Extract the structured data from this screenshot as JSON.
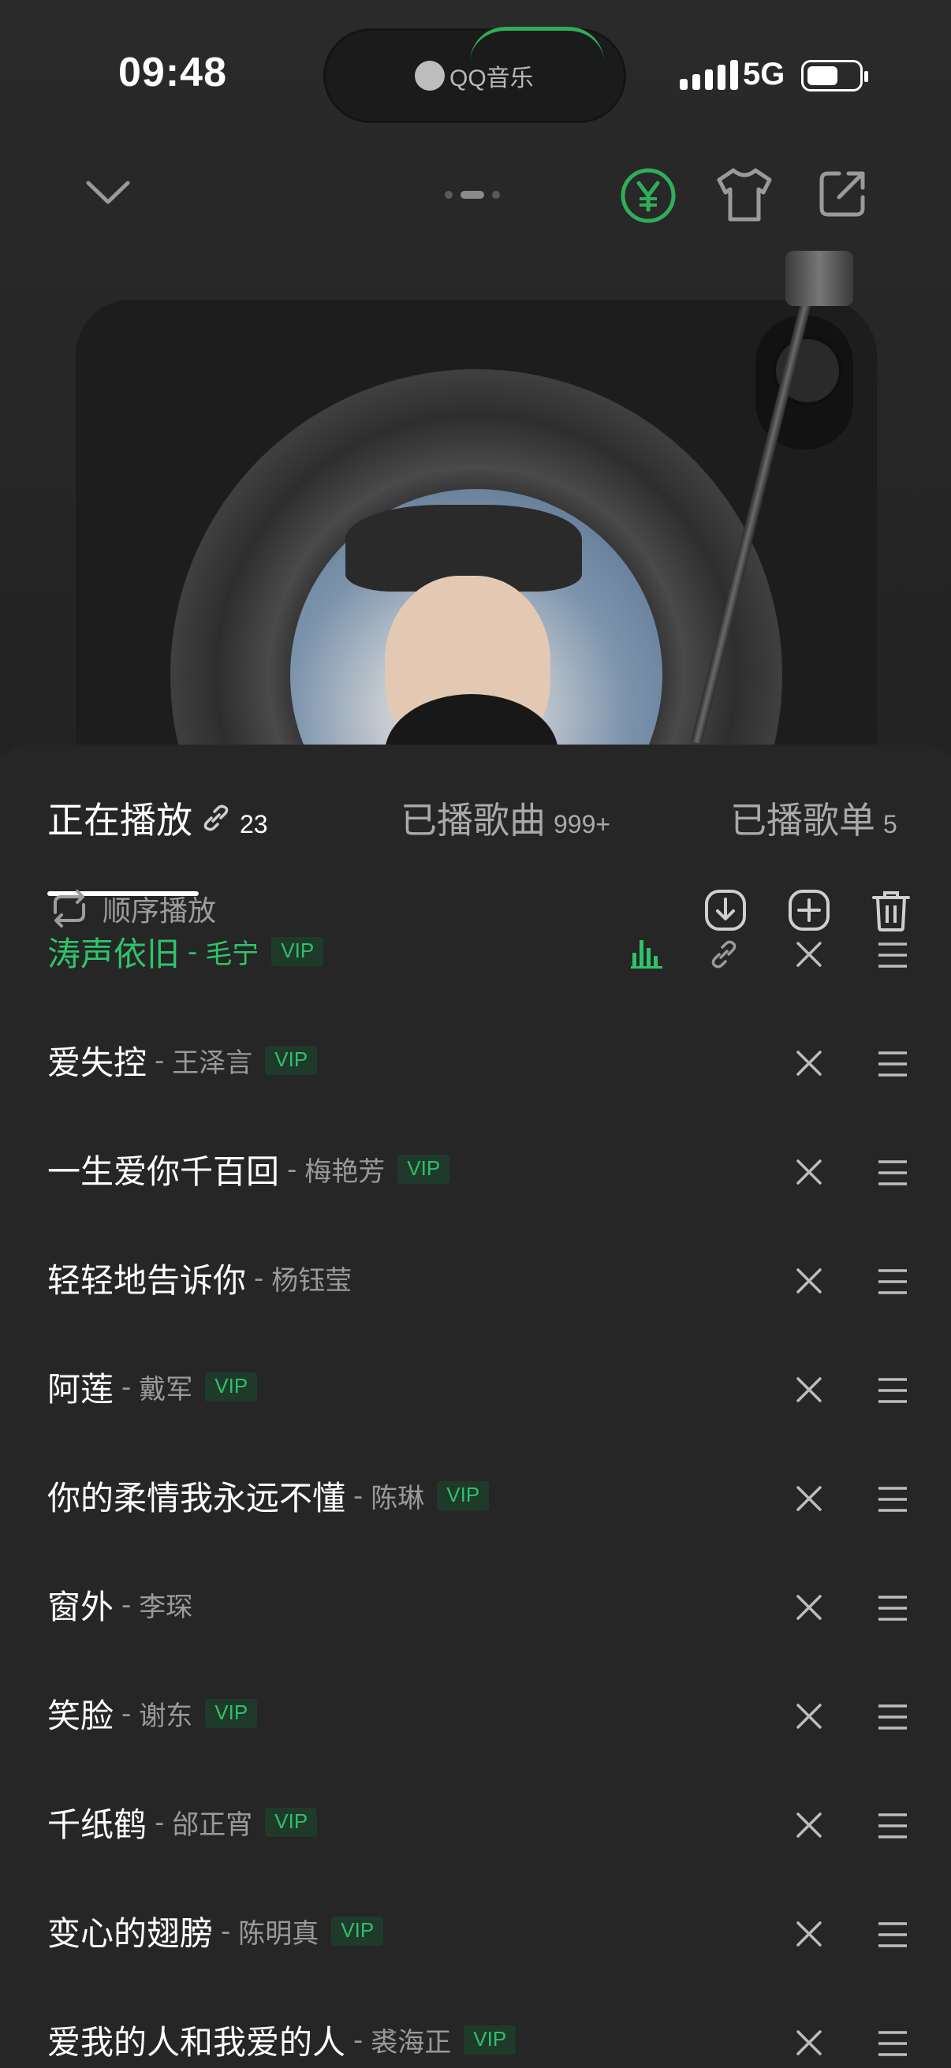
{
  "status": {
    "time": "09:48",
    "network": "5G",
    "island_app": "QQ音乐"
  },
  "header": {
    "icons": [
      "chevron-down-icon",
      "yuan-icon",
      "tshirt-icon",
      "share-icon"
    ]
  },
  "tabs": [
    {
      "label": "正在播放",
      "count": "23",
      "active": true
    },
    {
      "label": "已播歌曲",
      "count": "999+",
      "active": false
    },
    {
      "label": "已播歌单",
      "count": "5",
      "active": false
    }
  ],
  "mode": {
    "label": "顺序播放"
  },
  "accent": "#2ec46a",
  "playlist": [
    {
      "song": "涛声依旧",
      "sep": "-",
      "artist": "毛宁",
      "vip": "VIP"
    },
    {
      "song": "爱失控",
      "sep": "-",
      "artist": "王泽言",
      "vip": "VIP"
    },
    {
      "song": "一生爱你千百回",
      "sep": "-",
      "artist": "梅艳芳",
      "vip": "VIP"
    },
    {
      "song": "轻轻地告诉你",
      "sep": "-",
      "artist": "杨钰莹",
      "vip": ""
    },
    {
      "song": "阿莲",
      "sep": "-",
      "artist": "戴军",
      "vip": "VIP"
    },
    {
      "song": "你的柔情我永远不懂",
      "sep": "-",
      "artist": "陈琳",
      "vip": "VIP"
    },
    {
      "song": "窗外",
      "sep": "-",
      "artist": "李琛",
      "vip": ""
    },
    {
      "song": "笑脸",
      "sep": "-",
      "artist": "谢东",
      "vip": "VIP"
    },
    {
      "song": "千纸鹤",
      "sep": "-",
      "artist": "邰正宵",
      "vip": "VIP"
    },
    {
      "song": "变心的翅膀",
      "sep": "-",
      "artist": "陈明真",
      "vip": "VIP"
    },
    {
      "song": "爱我的人和我爱的人",
      "sep": "-",
      "artist": "裘海正",
      "vip": "VIP"
    }
  ]
}
